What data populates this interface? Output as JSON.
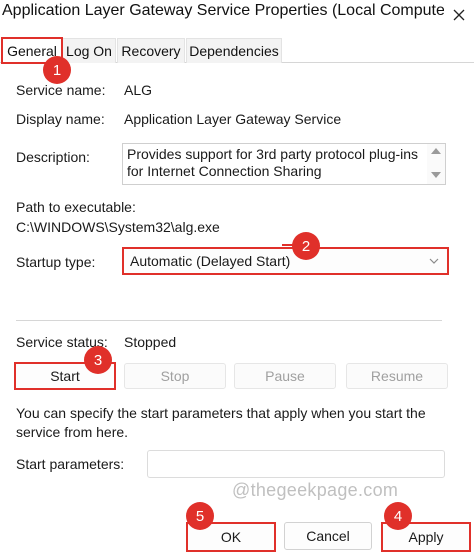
{
  "window": {
    "title": "Application Layer Gateway Service Properties (Local Computer)"
  },
  "tabs": [
    {
      "label": "General",
      "selected": true
    },
    {
      "label": "Log On",
      "selected": false
    },
    {
      "label": "Recovery",
      "selected": false
    },
    {
      "label": "Dependencies",
      "selected": false
    }
  ],
  "general": {
    "service_name_label": "Service name:",
    "service_name_value": "ALG",
    "display_name_label": "Display name:",
    "display_name_value": "Application Layer Gateway Service",
    "description_label": "Description:",
    "description_value": "Provides support for 3rd party protocol plug-ins for Internet Connection Sharing",
    "path_label": "Path to executable:",
    "path_value": "C:\\WINDOWS\\System32\\alg.exe",
    "startup_type_label": "Startup type:",
    "startup_type_value": "Automatic (Delayed Start)",
    "service_status_label": "Service status:",
    "service_status_value": "Stopped",
    "start_label": "Start",
    "stop_label": "Stop",
    "pause_label": "Pause",
    "resume_label": "Resume",
    "hint_text": "You can specify the start parameters that apply when you start the service from here.",
    "start_params_label": "Start parameters:",
    "start_params_value": ""
  },
  "footer": {
    "ok_label": "OK",
    "cancel_label": "Cancel",
    "apply_label": "Apply"
  },
  "watermark": "@thegeekpage.com",
  "annotations": {
    "badge_1": "1",
    "badge_2": "2",
    "badge_3": "3",
    "badge_4": "4",
    "badge_5": "5"
  },
  "colors": {
    "highlight": "#e0302a",
    "border": "#d2d2d2",
    "disabled_text": "#a0a0a0"
  },
  "icons": {
    "close": "close-icon",
    "dropdown": "chevron-down-icon",
    "scroll_up": "scroll-up-icon",
    "scroll_down": "scroll-down-icon"
  }
}
